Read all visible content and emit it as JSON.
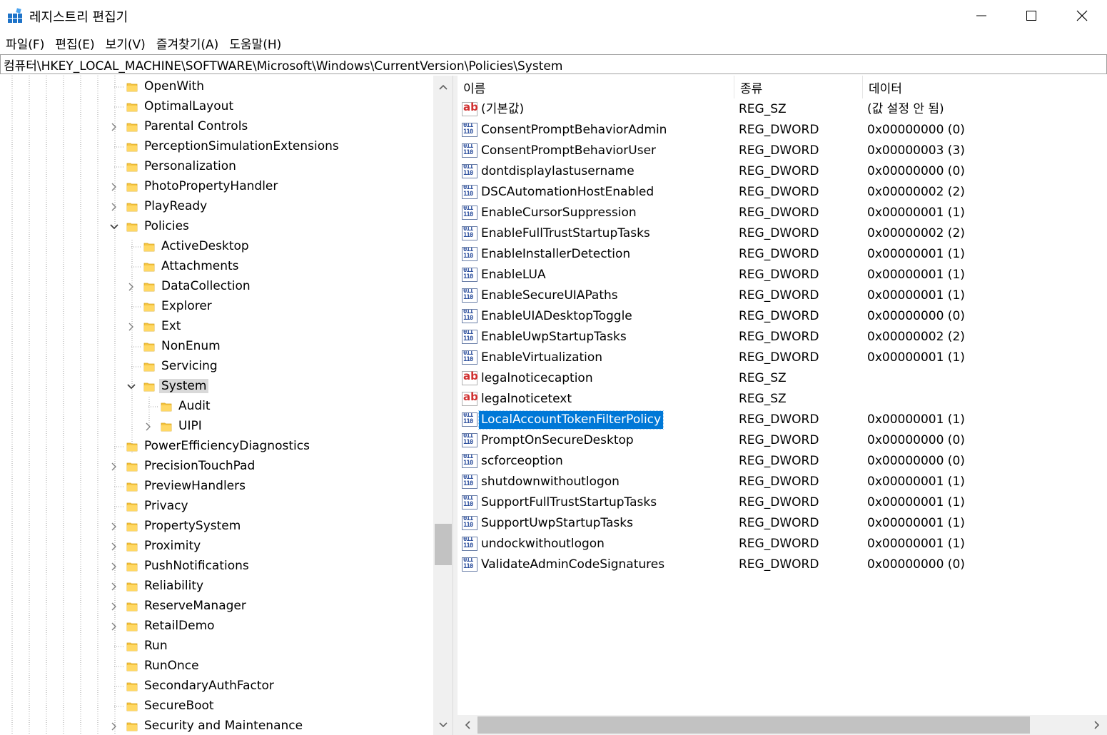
{
  "window": {
    "title": "레지스트리 편집기",
    "minimize_glyph": "—",
    "maximize_glyph": "☐",
    "close_glyph": "✕"
  },
  "menu": [
    "파일(F)",
    "편집(E)",
    "보기(V)",
    "즐겨찾기(A)",
    "도움말(H)"
  ],
  "address": "컴퓨터\\HKEY_LOCAL_MACHINE\\SOFTWARE\\Microsoft\\Windows\\CurrentVersion\\Policies\\System",
  "tree": [
    {
      "label": "OpenWith",
      "level": 0,
      "expander": "none"
    },
    {
      "label": "OptimalLayout",
      "level": 0,
      "expander": "none"
    },
    {
      "label": "Parental Controls",
      "level": 0,
      "expander": "collapsed"
    },
    {
      "label": "PerceptionSimulationExtensions",
      "level": 0,
      "expander": "none"
    },
    {
      "label": "Personalization",
      "level": 0,
      "expander": "none"
    },
    {
      "label": "PhotoPropertyHandler",
      "level": 0,
      "expander": "collapsed"
    },
    {
      "label": "PlayReady",
      "level": 0,
      "expander": "collapsed"
    },
    {
      "label": "Policies",
      "level": 0,
      "expander": "expanded"
    },
    {
      "label": "ActiveDesktop",
      "level": 1,
      "expander": "none"
    },
    {
      "label": "Attachments",
      "level": 1,
      "expander": "none"
    },
    {
      "label": "DataCollection",
      "level": 1,
      "expander": "collapsed"
    },
    {
      "label": "Explorer",
      "level": 1,
      "expander": "none"
    },
    {
      "label": "Ext",
      "level": 1,
      "expander": "collapsed"
    },
    {
      "label": "NonEnum",
      "level": 1,
      "expander": "none"
    },
    {
      "label": "Servicing",
      "level": 1,
      "expander": "none"
    },
    {
      "label": "System",
      "level": 1,
      "expander": "expanded",
      "selected": true
    },
    {
      "label": "Audit",
      "level": 2,
      "expander": "none"
    },
    {
      "label": "UIPI",
      "level": 2,
      "expander": "collapsed"
    },
    {
      "label": "PowerEfficiencyDiagnostics",
      "level": 0,
      "expander": "none"
    },
    {
      "label": "PrecisionTouchPad",
      "level": 0,
      "expander": "collapsed"
    },
    {
      "label": "PreviewHandlers",
      "level": 0,
      "expander": "none"
    },
    {
      "label": "Privacy",
      "level": 0,
      "expander": "none"
    },
    {
      "label": "PropertySystem",
      "level": 0,
      "expander": "collapsed"
    },
    {
      "label": "Proximity",
      "level": 0,
      "expander": "collapsed"
    },
    {
      "label": "PushNotifications",
      "level": 0,
      "expander": "collapsed"
    },
    {
      "label": "Reliability",
      "level": 0,
      "expander": "collapsed"
    },
    {
      "label": "ReserveManager",
      "level": 0,
      "expander": "collapsed"
    },
    {
      "label": "RetailDemo",
      "level": 0,
      "expander": "collapsed"
    },
    {
      "label": "Run",
      "level": 0,
      "expander": "none"
    },
    {
      "label": "RunOnce",
      "level": 0,
      "expander": "none"
    },
    {
      "label": "SecondaryAuthFactor",
      "level": 0,
      "expander": "none"
    },
    {
      "label": "SecureBoot",
      "level": 0,
      "expander": "none"
    },
    {
      "label": "Security and Maintenance",
      "level": 0,
      "expander": "collapsed"
    }
  ],
  "columns": {
    "name": "이름",
    "type": "종류",
    "data": "데이터"
  },
  "values": [
    {
      "icon": "string",
      "name": "(기본값)",
      "type": "REG_SZ",
      "data": "(값 설정 안 됨)"
    },
    {
      "icon": "binary",
      "name": "ConsentPromptBehaviorAdmin",
      "type": "REG_DWORD",
      "data": "0x00000000 (0)"
    },
    {
      "icon": "binary",
      "name": "ConsentPromptBehaviorUser",
      "type": "REG_DWORD",
      "data": "0x00000003 (3)"
    },
    {
      "icon": "binary",
      "name": "dontdisplaylastusername",
      "type": "REG_DWORD",
      "data": "0x00000000 (0)"
    },
    {
      "icon": "binary",
      "name": "DSCAutomationHostEnabled",
      "type": "REG_DWORD",
      "data": "0x00000002 (2)"
    },
    {
      "icon": "binary",
      "name": "EnableCursorSuppression",
      "type": "REG_DWORD",
      "data": "0x00000001 (1)"
    },
    {
      "icon": "binary",
      "name": "EnableFullTrustStartupTasks",
      "type": "REG_DWORD",
      "data": "0x00000002 (2)"
    },
    {
      "icon": "binary",
      "name": "EnableInstallerDetection",
      "type": "REG_DWORD",
      "data": "0x00000001 (1)"
    },
    {
      "icon": "binary",
      "name": "EnableLUA",
      "type": "REG_DWORD",
      "data": "0x00000001 (1)"
    },
    {
      "icon": "binary",
      "name": "EnableSecureUIAPaths",
      "type": "REG_DWORD",
      "data": "0x00000001 (1)"
    },
    {
      "icon": "binary",
      "name": "EnableUIADesktopToggle",
      "type": "REG_DWORD",
      "data": "0x00000000 (0)"
    },
    {
      "icon": "binary",
      "name": "EnableUwpStartupTasks",
      "type": "REG_DWORD",
      "data": "0x00000002 (2)"
    },
    {
      "icon": "binary",
      "name": "EnableVirtualization",
      "type": "REG_DWORD",
      "data": "0x00000001 (1)"
    },
    {
      "icon": "string",
      "name": "legalnoticecaption",
      "type": "REG_SZ",
      "data": ""
    },
    {
      "icon": "string",
      "name": "legalnoticetext",
      "type": "REG_SZ",
      "data": ""
    },
    {
      "icon": "binary",
      "name": "LocalAccountTokenFilterPolicy",
      "type": "REG_DWORD",
      "data": "0x00000001 (1)",
      "selected": true
    },
    {
      "icon": "binary",
      "name": "PromptOnSecureDesktop",
      "type": "REG_DWORD",
      "data": "0x00000000 (0)"
    },
    {
      "icon": "binary",
      "name": "scforceoption",
      "type": "REG_DWORD",
      "data": "0x00000000 (0)"
    },
    {
      "icon": "binary",
      "name": "shutdownwithoutlogon",
      "type": "REG_DWORD",
      "data": "0x00000001 (1)"
    },
    {
      "icon": "binary",
      "name": "SupportFullTrustStartupTasks",
      "type": "REG_DWORD",
      "data": "0x00000001 (1)"
    },
    {
      "icon": "binary",
      "name": "SupportUwpStartupTasks",
      "type": "REG_DWORD",
      "data": "0x00000001 (1)"
    },
    {
      "icon": "binary",
      "name": "undockwithoutlogon",
      "type": "REG_DWORD",
      "data": "0x00000001 (1)"
    },
    {
      "icon": "binary",
      "name": "ValidateAdminCodeSignatures",
      "type": "REG_DWORD",
      "data": "0x00000000 (0)"
    }
  ],
  "icons": {
    "string_glyph": "ab",
    "binary_glyph": "011\n110"
  },
  "colors": {
    "selection": "#0078d7",
    "folder": "#f5c542",
    "tree_selection": "#d9d9d9"
  }
}
